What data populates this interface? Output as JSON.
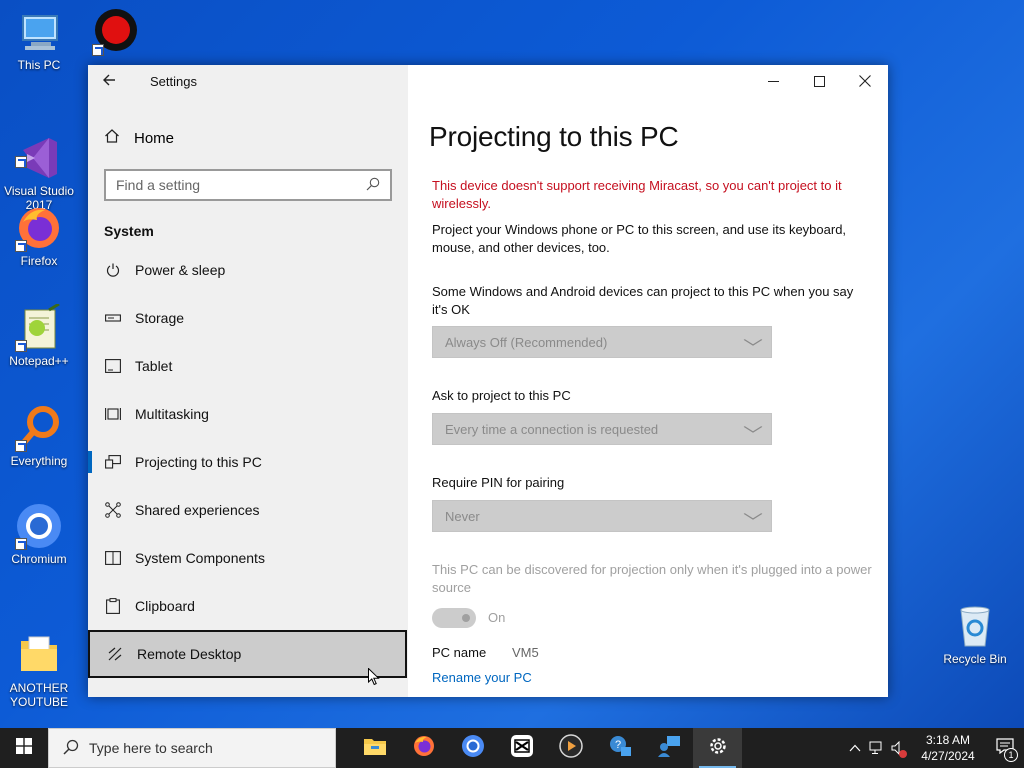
{
  "desktop": {
    "icons": [
      {
        "label": "This PC",
        "icon": "computer-icon"
      },
      {
        "label": "Bandicam",
        "icon": "record-icon"
      },
      {
        "label": "Visual Studio\n2017",
        "icon": "visual-studio-icon"
      },
      {
        "label": "Firefox",
        "icon": "firefox-icon"
      },
      {
        "label": "Notepad++",
        "icon": "notepad-plus-icon"
      },
      {
        "label": "Everything",
        "icon": "everything-search-icon"
      },
      {
        "label": "Chromium",
        "icon": "chromium-icon"
      },
      {
        "label": "ANOTHER\nYOUTUBE",
        "icon": "folder-icon"
      },
      {
        "label": "Recycle Bin",
        "icon": "recycle-bin-icon"
      }
    ]
  },
  "window": {
    "app_title": "Settings",
    "controls": {
      "minimize": "—",
      "maximize": "☐",
      "close": "✕"
    }
  },
  "sidebar": {
    "home_label": "Home",
    "search_placeholder": "Find a setting",
    "section_title": "System",
    "items": [
      {
        "label": "Power & sleep",
        "icon": "power-icon"
      },
      {
        "label": "Storage",
        "icon": "storage-icon"
      },
      {
        "label": "Tablet",
        "icon": "tablet-icon"
      },
      {
        "label": "Multitasking",
        "icon": "multitasking-icon"
      },
      {
        "label": "Projecting to this PC",
        "icon": "projecting-icon",
        "selected": true
      },
      {
        "label": "Shared experiences",
        "icon": "shared-experiences-icon"
      },
      {
        "label": "System Components",
        "icon": "system-components-icon"
      },
      {
        "label": "Clipboard",
        "icon": "clipboard-icon"
      },
      {
        "label": "Remote Desktop",
        "icon": "remote-desktop-icon",
        "hovered": true
      }
    ]
  },
  "content": {
    "title": "Projecting to this PC",
    "error": "This device doesn't support receiving Miracast, so you can't project to it wirelessly.",
    "description": "Project your Windows phone or PC to this screen, and use its keyboard, mouse, and other devices, too.",
    "setting1_label": "Some Windows and Android devices can project to this PC when you say it's OK",
    "setting1_value": "Always Off (Recommended)",
    "setting2_label": "Ask to project to this PC",
    "setting2_value": "Every time a connection is requested",
    "setting3_label": "Require PIN for pairing",
    "setting3_value": "Never",
    "power_note": "This PC can be discovered for projection only when it's plugged into a power source",
    "toggle_label": "On",
    "pc_name_label": "PC name",
    "pc_name_value": "VM5",
    "rename_link": "Rename your PC"
  },
  "taskbar": {
    "search_placeholder": "Type here to search",
    "apps": [
      {
        "icon": "file-explorer-icon"
      },
      {
        "icon": "firefox-icon"
      },
      {
        "icon": "chromium-icon"
      },
      {
        "icon": "capcut-icon"
      },
      {
        "icon": "media-player-icon"
      },
      {
        "icon": "quick-assist-icon"
      },
      {
        "icon": "people-icon"
      },
      {
        "icon": "settings-gear-icon",
        "active": true
      }
    ],
    "time": "3:18 AM",
    "date": "4/27/2024",
    "notification_count": "1"
  }
}
